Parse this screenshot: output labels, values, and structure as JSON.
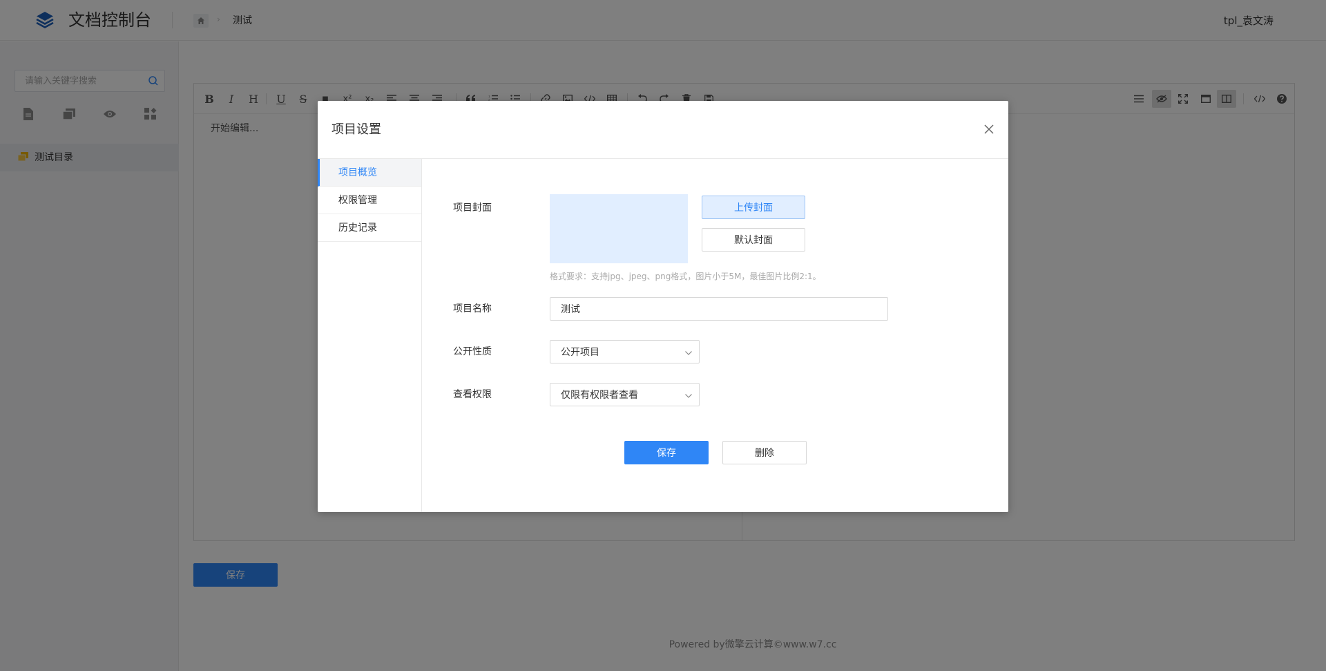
{
  "header": {
    "app_title": "文档控制台",
    "breadcrumb_current": "测试",
    "username": "tpl_袁文涛",
    "icons": [
      "layers-logo-icon",
      "home-icon",
      "chevron-right-icon"
    ]
  },
  "sidebar": {
    "search_placeholder": "请输入关键字搜索",
    "tool_icons": [
      "document-icon",
      "copy-icon",
      "eye-icon",
      "grid-plus-icon"
    ],
    "tree_item_label": "测试目录"
  },
  "editor": {
    "placeholder": "开始编辑...",
    "toolbar_left": [
      "B",
      "I",
      "H",
      "U",
      "S",
      "■",
      "x²",
      "x₂"
    ],
    "save_label": "保存"
  },
  "footer": {
    "text": "Powered by微擎云计算©www.w7.cc"
  },
  "modal": {
    "title": "项目设置",
    "nav": [
      {
        "label": "项目概览",
        "active": true
      },
      {
        "label": "权限管理",
        "active": false
      },
      {
        "label": "历史记录",
        "active": false
      }
    ],
    "cover_label": "项目封面",
    "upload_cover_label": "上传封面",
    "default_cover_label": "默认封面",
    "cover_hint": "格式要求：支持jpg、jpeg、png格式，图片小于5M，最佳图片比例2:1。",
    "name_label": "项目名称",
    "name_value": "测试",
    "public_label": "公开性质",
    "public_value": "公开项目",
    "view_label": "查看权限",
    "view_value": "仅限有权限者查看",
    "save_label": "保存",
    "delete_label": "删除"
  },
  "colors": {
    "accent": "#2f86f6",
    "cover_bg": "#e1eeff",
    "overlay": "rgba(0,0,0,0.5)"
  }
}
